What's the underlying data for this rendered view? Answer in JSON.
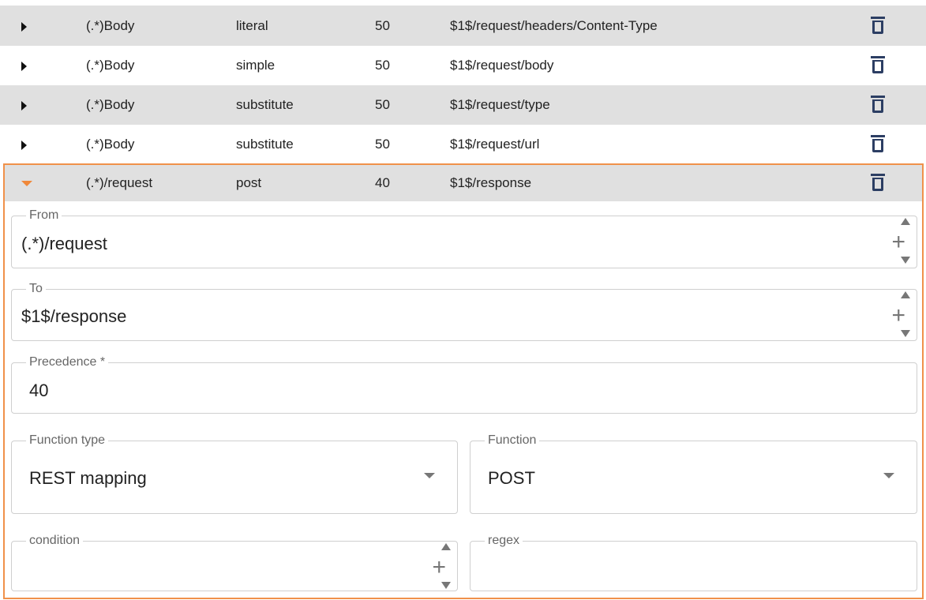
{
  "rows": [
    {
      "from": "(.*)Body",
      "type": "literal",
      "precedence": "50",
      "to": "$1$/request/headers/Content-Type"
    },
    {
      "from": "(.*)Body",
      "type": "simple",
      "precedence": "50",
      "to": "$1$/request/body"
    },
    {
      "from": "(.*)Body",
      "type": "substitute",
      "precedence": "50",
      "to": "$1$/request/type"
    },
    {
      "from": "(.*)Body",
      "type": "substitute",
      "precedence": "50",
      "to": "$1$/request/url"
    },
    {
      "from": "(.*)/request",
      "type": "post",
      "precedence": "40",
      "to": "$1$/response"
    }
  ],
  "form": {
    "from": {
      "label": "From",
      "value": "(.*)/request"
    },
    "to": {
      "label": "To",
      "value": "$1$/response"
    },
    "precedence": {
      "label": "Precedence *",
      "value": "40"
    },
    "function_type": {
      "label": "Function type",
      "value": "REST mapping"
    },
    "function": {
      "label": "Function",
      "value": "POST"
    },
    "condition": {
      "label": "condition",
      "value": ""
    },
    "regex": {
      "label": "regex",
      "value": ""
    }
  },
  "icons": {
    "expand": "caret-right-icon",
    "collapse": "caret-down-icon",
    "delete": "trash-icon",
    "stepper": "plus-stepper-icon"
  },
  "colors": {
    "row_alt": "#e0e0e0",
    "accent": "#f0914a",
    "icon": "#2c3e63"
  }
}
